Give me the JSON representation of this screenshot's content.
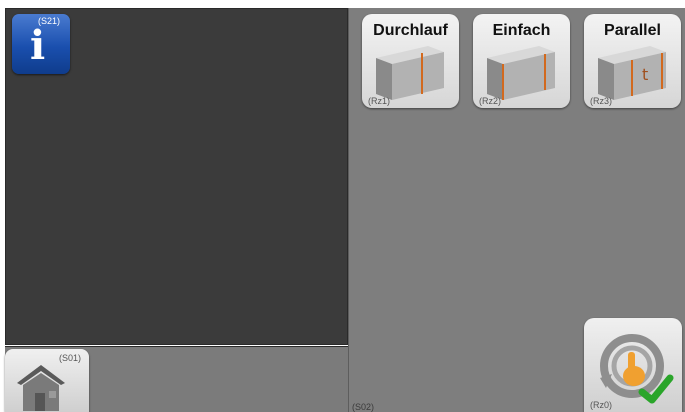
{
  "info_button": {
    "code": "(S21)",
    "icon": "info-icon"
  },
  "mode_buttons": [
    {
      "label": "Durchlauf",
      "code": "(Rz1)",
      "icon": "profile-one-edge-icon"
    },
    {
      "label": "Einfach",
      "code": "(Rz2)",
      "icon": "profile-two-edges-icon"
    },
    {
      "label": "Parallel",
      "code": "(Rz3)",
      "icon": "profile-parallel-t-icon"
    }
  ],
  "home_button": {
    "code": "(S01)",
    "icon": "house-icon"
  },
  "confirm_button": {
    "code": "(Rz0)",
    "icon": "hand-cycle-checkmark-icon"
  },
  "right_panel": {
    "code": "(S02)"
  },
  "colors": {
    "left_panel": "#3b3b3b",
    "right_panel": "#7e7e7e",
    "info_blue": "#1a4fae",
    "edge_orange": "#d2691e",
    "check_green": "#2aa52a"
  }
}
